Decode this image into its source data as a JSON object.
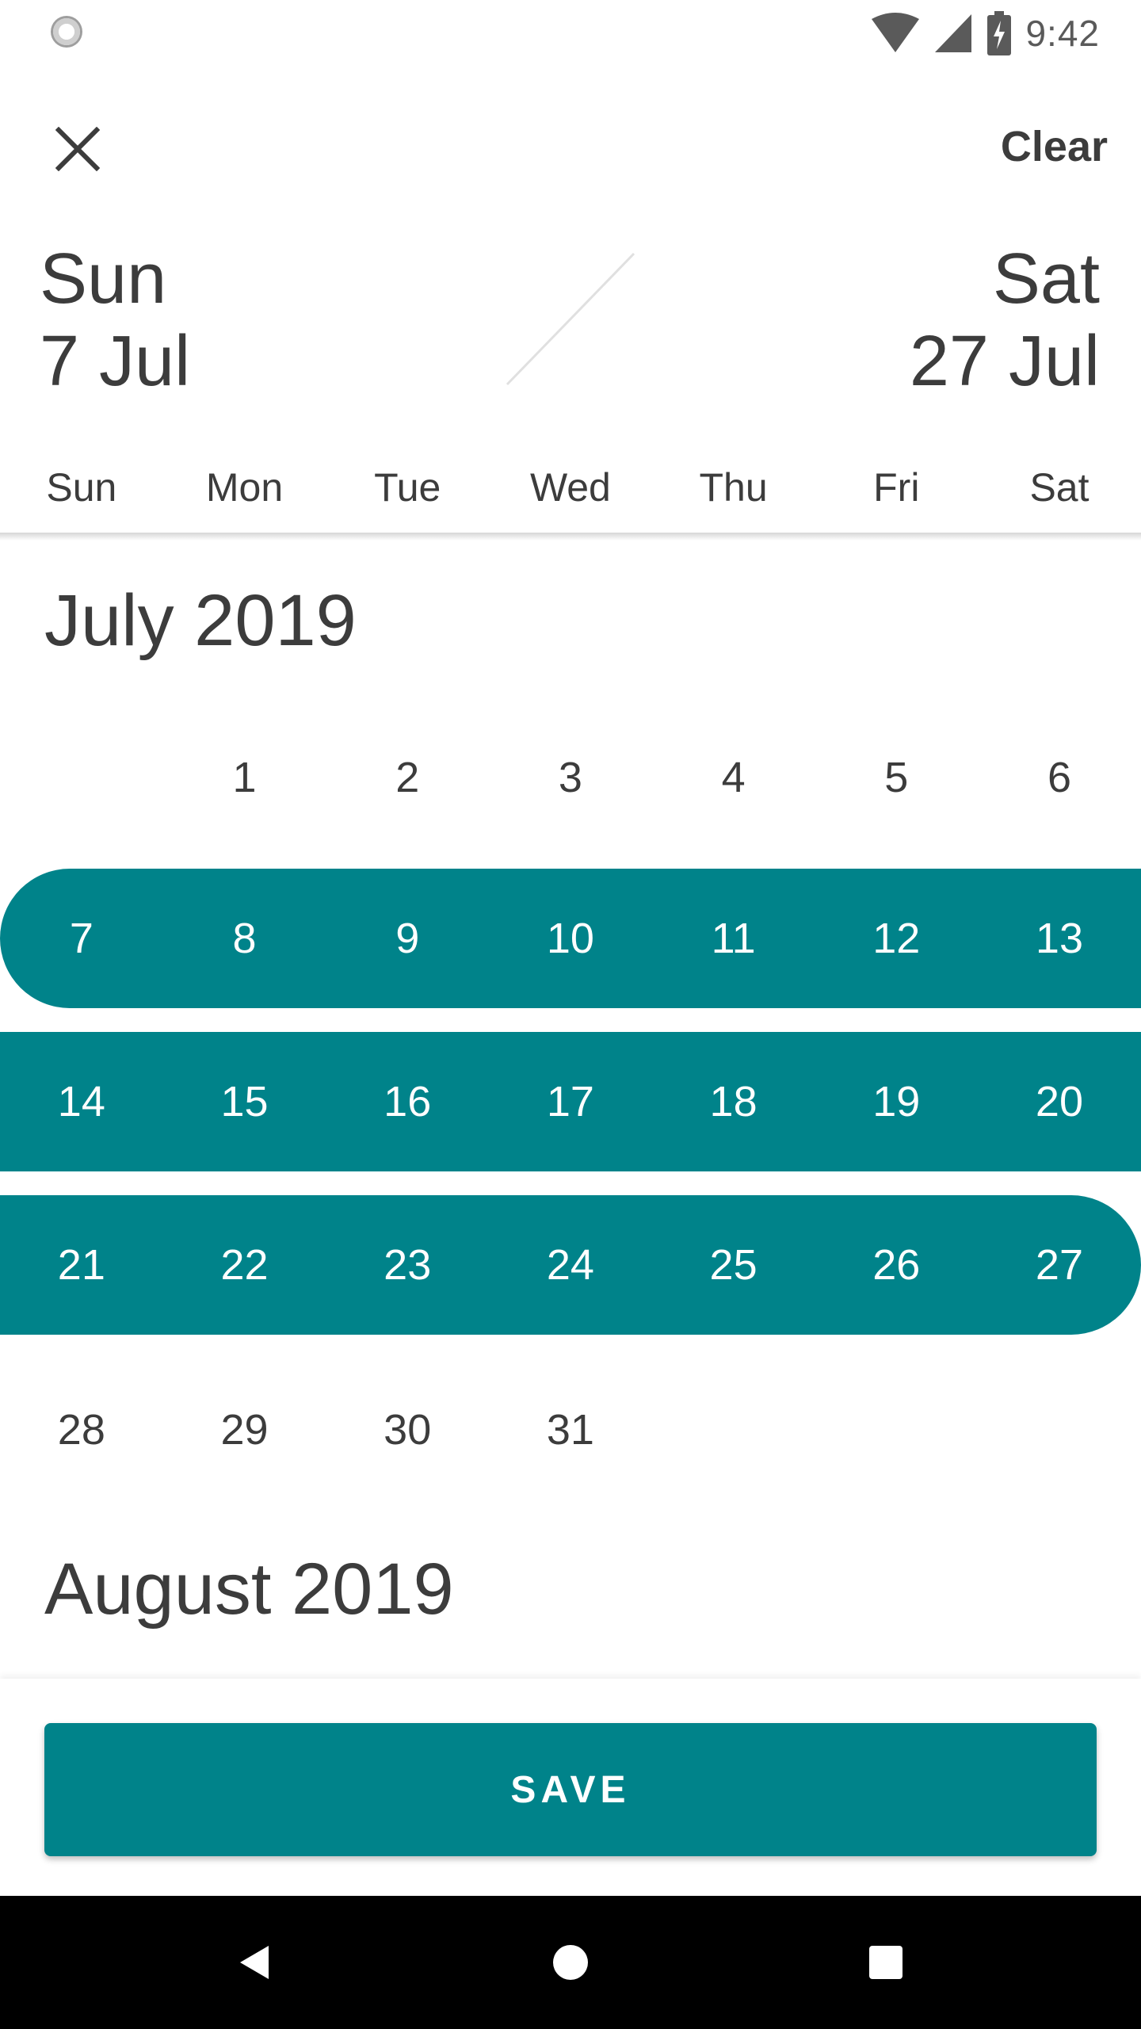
{
  "status_bar": {
    "time": "9:42",
    "icons": [
      "sync-spinner-icon",
      "wifi-icon",
      "cellular-signal-icon",
      "battery-charging-icon"
    ]
  },
  "header": {
    "close_icon": "close-icon",
    "clear_label": "Clear"
  },
  "range": {
    "start_weekday": "Sun",
    "start_date": "7 Jul",
    "end_weekday": "Sat",
    "end_date": "27 Jul"
  },
  "weekdays": [
    "Sun",
    "Mon",
    "Tue",
    "Wed",
    "Thu",
    "Fri",
    "Sat"
  ],
  "months": [
    {
      "title": "July 2019",
      "weeks": [
        [
          "",
          "1",
          "2",
          "3",
          "4",
          "5",
          "6"
        ],
        [
          "7",
          "8",
          "9",
          "10",
          "11",
          "12",
          "13"
        ],
        [
          "14",
          "15",
          "16",
          "17",
          "18",
          "19",
          "20"
        ],
        [
          "21",
          "22",
          "23",
          "24",
          "25",
          "26",
          "27"
        ],
        [
          "28",
          "29",
          "30",
          "31",
          "",
          "",
          ""
        ]
      ],
      "selected_start": "7",
      "selected_end": "27"
    },
    {
      "title": "August 2019"
    }
  ],
  "save_label": "SAVE",
  "nav_bar": {
    "icons": [
      "back-icon",
      "home-icon",
      "recents-icon"
    ]
  },
  "colors": {
    "accent": "#00838a",
    "text": "#3c3c3c",
    "nav_bar": "#000000"
  }
}
